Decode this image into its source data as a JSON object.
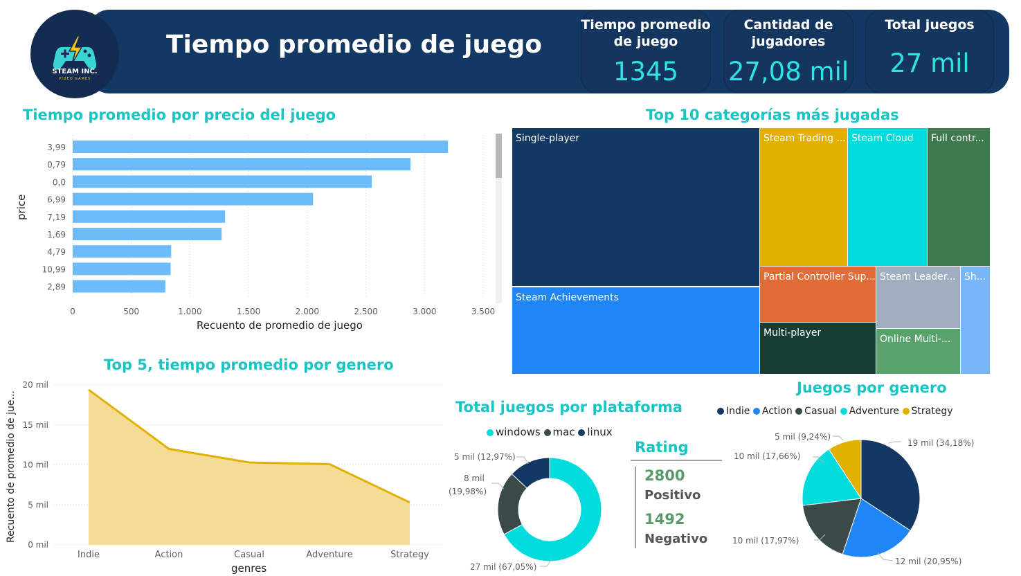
{
  "header": {
    "title": "Tiempo promedio de juego",
    "logo": {
      "name": "STEAM INC.",
      "subtitle": "VIDEO GAMES",
      "icon": "gamepad-lightning-icon"
    },
    "kpis": [
      {
        "title_line1": "Tiempo promedio",
        "title_line2": "de juego",
        "value": "1345"
      },
      {
        "title_line1": "Cantidad de",
        "title_line2": "jugadores",
        "value": "27,08 mil"
      },
      {
        "title_line1": "Total juegos",
        "title_line2": "",
        "value": "27 mil"
      }
    ]
  },
  "colors": {
    "header_bg": "#133863",
    "accent": "#19c4c4",
    "bar": "#6cbcfb",
    "area_line": "#e2b000",
    "area_fill": "#f4dc97"
  },
  "bar_section": {
    "title": "Tiempo promedio por precio del juego"
  },
  "area_section": {
    "title": "Top 5, tiempo promedio por genero"
  },
  "treemap_section": {
    "title": "Top 10 categorías más jugadas"
  },
  "donut_section": {
    "title": "Total juegos por plataforma"
  },
  "pie_section": {
    "title": "Juegos por genero"
  },
  "rating": {
    "title": "Rating",
    "positive_value": "2800",
    "positive_label": "Positivo",
    "negative_value": "1492",
    "negative_label": "Negativo"
  },
  "chart_data": [
    {
      "type": "bar",
      "orientation": "horizontal",
      "title": "Tiempo promedio por precio del juego",
      "xlabel": "Recuento de promedio de juego",
      "ylabel": "price",
      "categories": [
        "3,99",
        "0,79",
        "0,0",
        "6,99",
        "7,19",
        "1,69",
        "4,79",
        "10,99",
        "2,89"
      ],
      "values": [
        3200,
        2880,
        2550,
        2050,
        1300,
        1270,
        840,
        835,
        790
      ],
      "xlim": [
        0,
        3500
      ],
      "xticks": [
        "0",
        "500",
        "1.000",
        "1.500",
        "2.000",
        "2.500",
        "3.000",
        "3.500"
      ],
      "grid": true
    },
    {
      "type": "area",
      "title": "Top 5, tiempo promedio por genero",
      "xlabel": "genres",
      "ylabel": "Recuento de promedio de jue...",
      "categories": [
        "Indie",
        "Action",
        "Casual",
        "Adventure",
        "Strategy"
      ],
      "values": [
        19400,
        12000,
        10300,
        10100,
        5300
      ],
      "ylim": [
        0,
        20000
      ],
      "yticks": [
        "0 mil",
        "5 mil",
        "10 mil",
        "15 mil",
        "20 mil"
      ],
      "grid": true
    },
    {
      "type": "treemap",
      "title": "Top 10 categorías más jugadas",
      "items": [
        {
          "label": "Single-player",
          "color": "#133863"
        },
        {
          "label": "Steam Achievements",
          "color": "#2186f5"
        },
        {
          "label": "Steam Trading ...",
          "color": "#e2b000"
        },
        {
          "label": "Steam Cloud",
          "color": "#00dcdc"
        },
        {
          "label": "Full contr...",
          "color": "#3f7a4f"
        },
        {
          "label": "Partial Controller Sup...",
          "color": "#e26c38"
        },
        {
          "label": "Multi-player",
          "color": "#173e35"
        },
        {
          "label": "Steam Leader...",
          "color": "#a0aec0"
        },
        {
          "label": "Online Multi-...",
          "color": "#58a36c"
        },
        {
          "label": "Sh...",
          "color": "#78b6f8"
        }
      ]
    },
    {
      "type": "pie",
      "donut": true,
      "title": "Total juegos por plataforma",
      "legend_position": "top",
      "series": [
        {
          "name": "windows",
          "value": 67.05,
          "label": "27 mil (67,05%)",
          "color": "#00dcdc"
        },
        {
          "name": "mac",
          "value": 19.98,
          "label_line1": "8 mil",
          "label_line2": "(19,98%)",
          "color": "#3a4a49"
        },
        {
          "name": "linux",
          "value": 12.97,
          "label": "5 mil (12,97%)",
          "color": "#133863"
        }
      ]
    },
    {
      "type": "pie",
      "title": "Juegos por genero",
      "legend_position": "top",
      "series": [
        {
          "name": "Indie",
          "value": 34.18,
          "label": "19 mil (34,18%)",
          "color": "#133863"
        },
        {
          "name": "Action",
          "value": 20.95,
          "label": "12 mil (20,95%)",
          "color": "#2186f5"
        },
        {
          "name": "Casual",
          "value": 17.97,
          "label": "10 mil (17,97%)",
          "color": "#3a4a49"
        },
        {
          "name": "Adventure",
          "value": 17.66,
          "label": "10 mil (17,66%)",
          "color": "#00dcdc"
        },
        {
          "name": "Strategy",
          "value": 9.24,
          "label": "5 mil (9,24%)",
          "color": "#e2b000"
        }
      ]
    }
  ]
}
